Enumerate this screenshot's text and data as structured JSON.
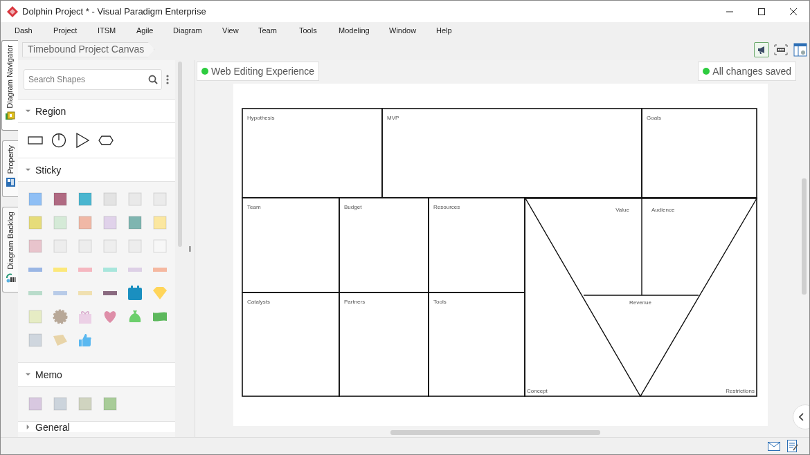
{
  "window": {
    "title": "Dolphin Project * - Visual Paradigm Enterprise"
  },
  "menu": [
    "Dash",
    "Project",
    "ITSM",
    "Agile",
    "Diagram",
    "View",
    "Team",
    "Tools",
    "Modeling",
    "Window",
    "Help"
  ],
  "side_tabs": [
    {
      "label": "Diagram Navigator",
      "selected": true
    },
    {
      "label": "Property",
      "selected": false
    },
    {
      "label": "Diagram Backlog",
      "selected": false
    }
  ],
  "breadcrumb": "Timebound Project Canvas",
  "palette": {
    "search": {
      "placeholder": "Search Shapes"
    },
    "sections": [
      {
        "kind": "region",
        "title": "Region",
        "expanded": true
      },
      {
        "kind": "sticky",
        "title": "Sticky",
        "expanded": true
      },
      {
        "kind": "memo",
        "title": "Memo",
        "expanded": true
      },
      {
        "kind": "general",
        "title": "General",
        "expanded": false
      }
    ]
  },
  "canvas": {
    "status_left": "Web Editing Experience",
    "status_right": "All changes saved",
    "regions": [
      {
        "label": "Hypothesis"
      },
      {
        "label": "MVP"
      },
      {
        "label": "Goals"
      },
      {
        "label": "Team"
      },
      {
        "label": "Budget"
      },
      {
        "label": "Resources"
      },
      {
        "label": "Catalysts"
      },
      {
        "label": "Partners"
      },
      {
        "label": "Tools"
      },
      {
        "label": "Value"
      },
      {
        "label": "Audience"
      },
      {
        "label": "Revenue"
      },
      {
        "label": "Concept"
      },
      {
        "label": "Restrictions"
      }
    ]
  }
}
